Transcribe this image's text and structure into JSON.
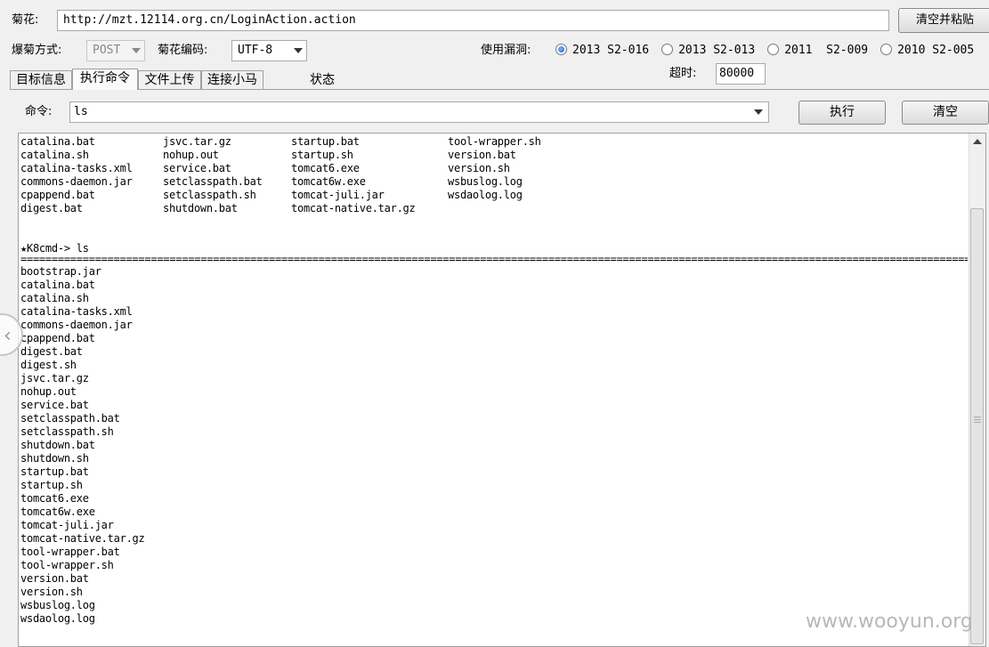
{
  "url_bar": {
    "label": "菊花:",
    "value": "http://mzt.12114.org.cn/LoginAction.action",
    "clear_paste_button": "清空并粘贴"
  },
  "options": {
    "method_label": "爆菊方式:",
    "method_value": "POST",
    "encoding_label": "菊花编码:",
    "encoding_value": "UTF-8",
    "vuln_label": "使用漏洞:",
    "vulns": [
      {
        "label": "2013 S2-016",
        "selected": true
      },
      {
        "label": "2013 S2-013",
        "selected": false
      },
      {
        "label": "2011  S2-009",
        "selected": false
      },
      {
        "label": "2010 S2-005",
        "selected": false
      }
    ],
    "timeout_label": "超时:",
    "timeout_value": "80000"
  },
  "tabs": [
    {
      "label": "目标信息",
      "active": false
    },
    {
      "label": "执行命令",
      "active": true
    },
    {
      "label": "文件上传",
      "active": false
    },
    {
      "label": "连接小马",
      "active": false
    }
  ],
  "status_label": "状态",
  "command": {
    "label": "命令:",
    "value": "ls",
    "execute_button": "执行",
    "clear_button": "清空"
  },
  "output": {
    "columns": [
      [
        "catalina.bat",
        "catalina.sh",
        "catalina-tasks.xml",
        "commons-daemon.jar",
        "cpappend.bat",
        "digest.bat"
      ],
      [
        "jsvc.tar.gz",
        "nohup.out",
        "service.bat",
        "setclasspath.bat",
        "setclasspath.sh",
        "shutdown.bat"
      ],
      [
        "startup.bat",
        "startup.sh",
        "tomcat6.exe",
        "tomcat6w.exe",
        "tomcat-juli.jar",
        "tomcat-native.tar.gz"
      ],
      [
        "tool-wrapper.sh",
        "version.bat",
        "version.sh",
        "wsbuslog.log",
        "wsdaolog.log",
        ""
      ]
    ],
    "prompt": "★K8cmd-> ls",
    "files": [
      "bootstrap.jar",
      "catalina.bat",
      "catalina.sh",
      "catalina-tasks.xml",
      "commons-daemon.jar",
      "cpappend.bat",
      "digest.bat",
      "digest.sh",
      "jsvc.tar.gz",
      "nohup.out",
      "service.bat",
      "setclasspath.bat",
      "setclasspath.sh",
      "shutdown.bat",
      "shutdown.sh",
      "startup.bat",
      "startup.sh",
      "tomcat6.exe",
      "tomcat6w.exe",
      "tomcat-juli.jar",
      "tomcat-native.tar.gz",
      "tool-wrapper.bat",
      "tool-wrapper.sh",
      "version.bat",
      "version.sh",
      "wsbuslog.log",
      "wsdaolog.log"
    ]
  },
  "watermark": "www.wooyun.org"
}
